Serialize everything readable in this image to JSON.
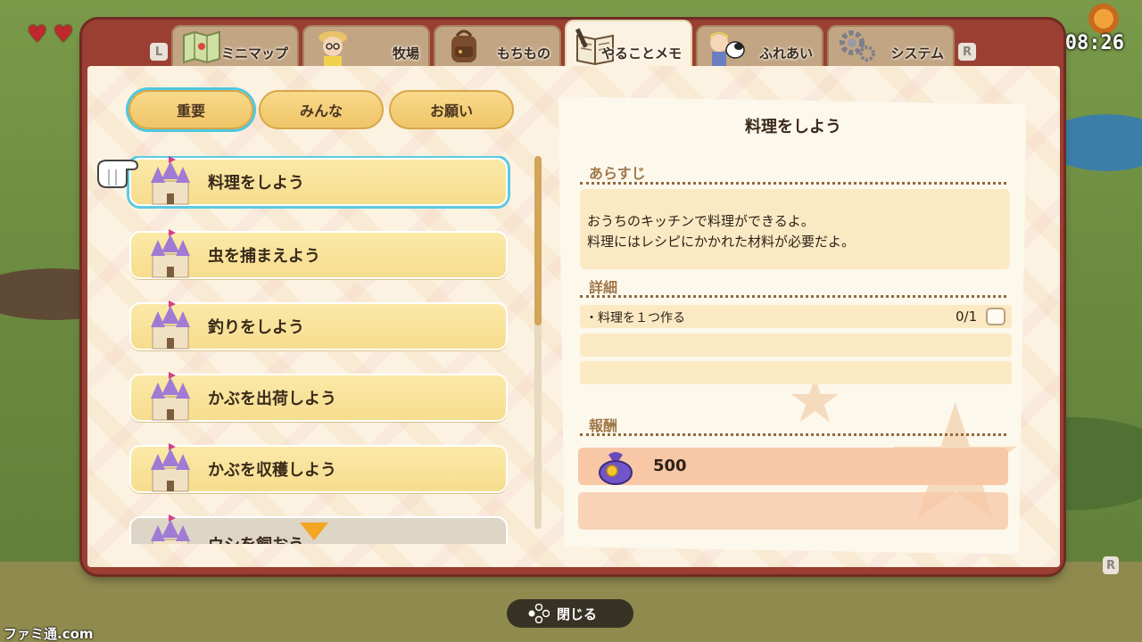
{
  "hud": {
    "clock": "08:26",
    "hearts": 2
  },
  "tabs": {
    "left_shoulder": "L",
    "right_shoulder": "R",
    "items": [
      {
        "label": "ミニマップ",
        "icon": "map-icon",
        "active": false
      },
      {
        "label": "牧場",
        "icon": "farmer-portrait-icon",
        "active": false
      },
      {
        "label": "もちもの",
        "icon": "backpack-icon",
        "active": false
      },
      {
        "label": "やることメモ",
        "icon": "notebook-icon",
        "active": true
      },
      {
        "label": "ふれあい",
        "icon": "friends-portrait-icon",
        "active": false
      },
      {
        "label": "システム",
        "icon": "gear-icon",
        "active": false
      }
    ]
  },
  "categories": [
    {
      "label": "重要",
      "active": true
    },
    {
      "label": "みんな",
      "active": false
    },
    {
      "label": "お願い",
      "active": false
    }
  ],
  "quests": [
    {
      "label": "料理をしよう",
      "icon": "castle-icon",
      "selected": true
    },
    {
      "label": "虫を捕まえよう",
      "icon": "castle-icon",
      "selected": false
    },
    {
      "label": "釣りをしよう",
      "icon": "castle-icon",
      "selected": false
    },
    {
      "label": "かぶを出荷しよう",
      "icon": "castle-icon",
      "selected": false
    },
    {
      "label": "かぶを収穫しよう",
      "icon": "castle-icon",
      "selected": false
    },
    {
      "label": "ウシを飼おう",
      "icon": "castle-icon",
      "selected": false
    }
  ],
  "detail": {
    "title": "料理をしよう",
    "synopsis_heading": "あらすじ",
    "synopsis_lines": [
      "おうちのキッチンで料理ができるよ。",
      "料理にはレシピにかかれた材料が必要だよ。"
    ],
    "details_heading": "詳細",
    "task": {
      "label": "・料理を１つ作る",
      "progress": "0/1",
      "done": false
    },
    "reward_heading": "報酬",
    "reward": {
      "value": "500",
      "icon": "money-bag-icon"
    }
  },
  "footer": {
    "close_label": "閉じる",
    "button_icon": "face-buttons-icon"
  },
  "watermark": "ファミ通.com",
  "colors": {
    "frame": "#9b3f32",
    "panel": "#fbf2e1",
    "highlight": "#5cc9e0",
    "quest_bg": "#f6dd8e",
    "reward_bg": "#f7c7a6"
  }
}
